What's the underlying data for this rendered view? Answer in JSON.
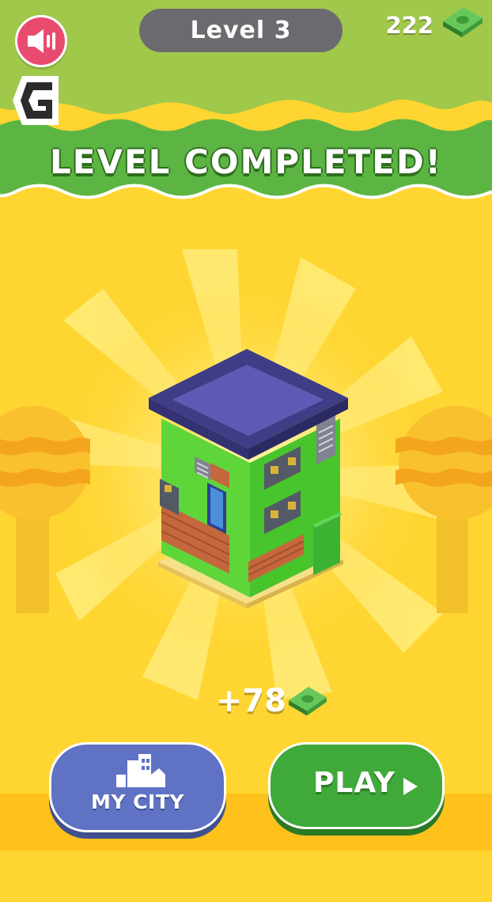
{
  "hud": {
    "level_label": "Level 3",
    "cash": "222",
    "sound_icon": "speaker-icon",
    "logo_icon": "g-logo-icon"
  },
  "banner": {
    "title": "LEVEL COMPLETED!"
  },
  "reward": {
    "amount": "+78",
    "icon": "cash-icon"
  },
  "buttons": {
    "my_city_label": "MY CITY",
    "my_city_icon": "city-icon",
    "play_label": "PLAY",
    "play_icon": "play-arrow-icon"
  },
  "colors": {
    "background": "#ffd531",
    "header_green": "#a0c84a",
    "banner_green": "#5cb543",
    "sound_button": "#e94b6f",
    "level_pill": "#6b6a6e",
    "my_city_button": "#5f72c4",
    "play_button": "#3fa93a"
  }
}
